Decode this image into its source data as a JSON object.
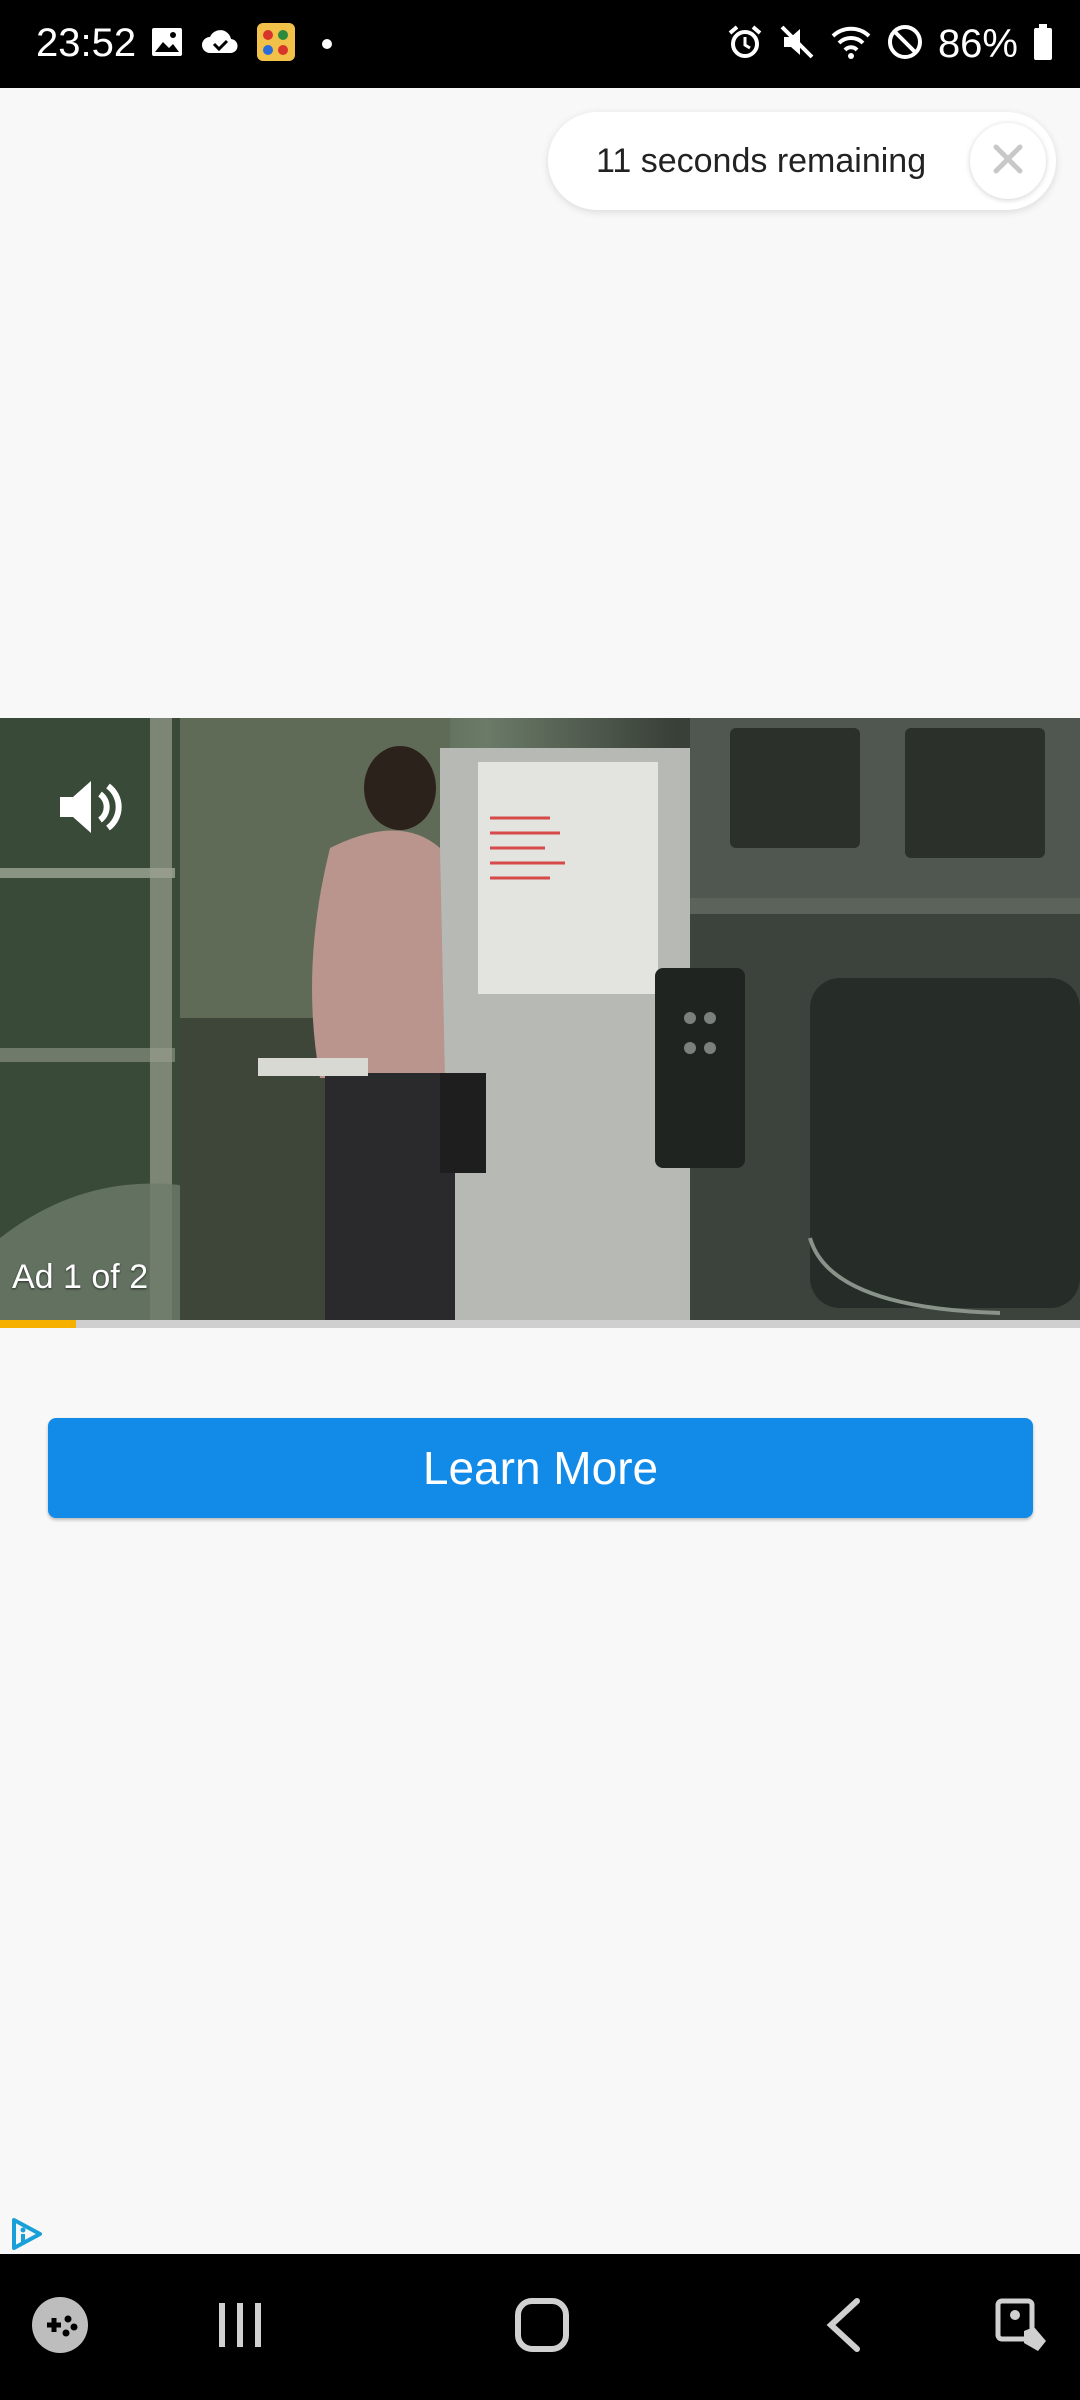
{
  "status_bar": {
    "time": "23:52",
    "battery": "86%",
    "left_icons": [
      "gallery-icon",
      "cloud-check-icon",
      "app-icon",
      "dot-icon"
    ],
    "right_icons": [
      "alarm-icon",
      "mute-icon",
      "wifi-icon",
      "do-not-disturb-icon",
      "battery-icon"
    ]
  },
  "countdown": {
    "text": "11 seconds remaining"
  },
  "video": {
    "ad_label": "Ad 1 of 2",
    "progress_fraction": 0.07
  },
  "cta": {
    "label": "Learn More"
  },
  "nav_bar": {
    "items": [
      "game-launcher-icon",
      "recents-icon",
      "home-icon",
      "back-icon",
      "accessibility-icon"
    ]
  },
  "colors": {
    "cta_blue": "#128ae8",
    "progress_yellow": "#f5b000",
    "background": "#f8f8f8"
  }
}
